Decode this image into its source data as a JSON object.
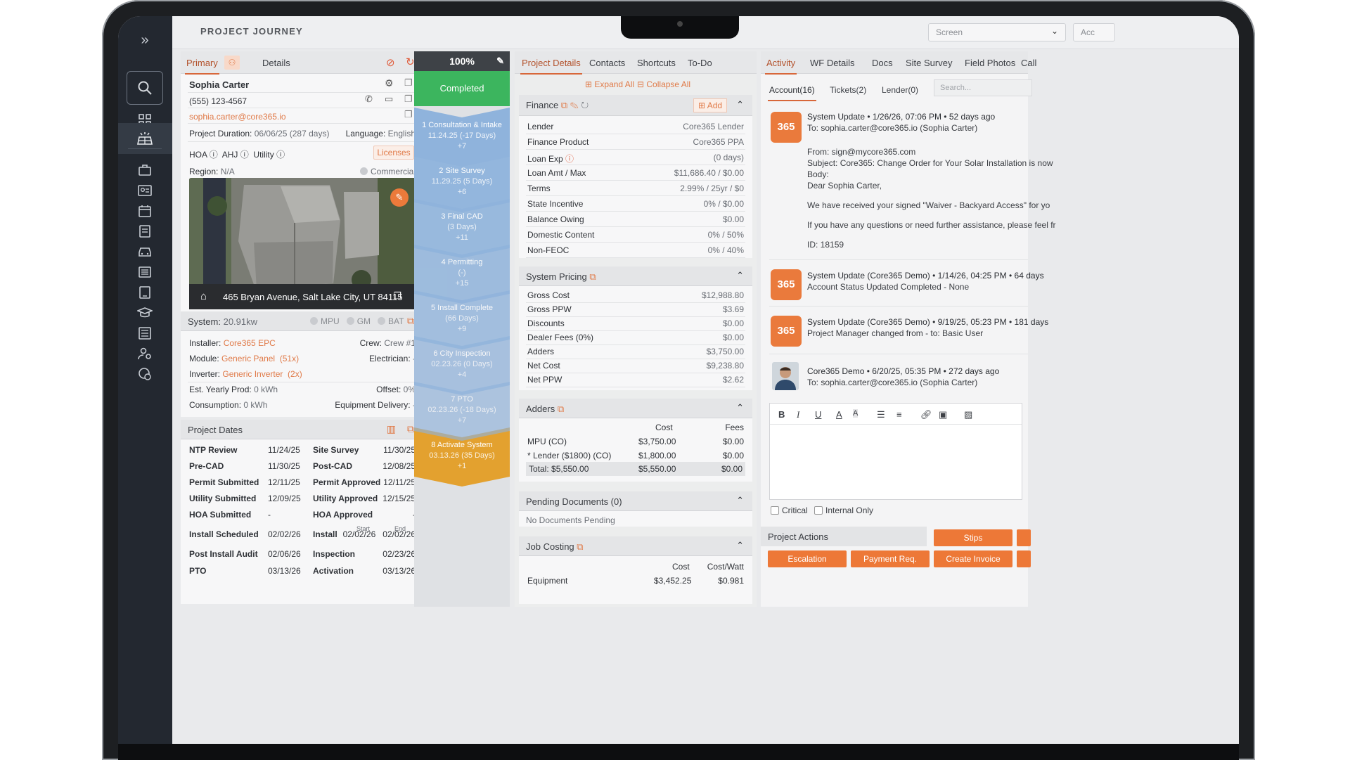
{
  "header": {
    "title": "PROJECT JOURNEY",
    "screen_select": "Screen",
    "acc_label": "Acc"
  },
  "primary": {
    "tabs": [
      "Primary",
      "Details"
    ],
    "name": "Sophia Carter",
    "phone": "(555) 123-4567",
    "email": "sophia.carter@core365.io",
    "duration_label": "Project Duration:",
    "duration_value": "06/06/25 (287 days)",
    "language_label": "Language:",
    "language_value": "English",
    "hoa": "HOA",
    "ahj": "AHJ",
    "utility": "Utility",
    "licenses": "Licenses",
    "region_label": "Region:",
    "region_value": "N/A",
    "commercial": "Commercial",
    "address": "465 Bryan Avenue, Salt Lake City, UT 84115"
  },
  "system": {
    "title": "System:",
    "size": "20.91kw",
    "flags": [
      "MPU",
      "GM",
      "BAT"
    ],
    "installer_label": "Installer:",
    "installer": "Core365 EPC",
    "crew_label": "Crew:",
    "crew": "Crew #1",
    "module_label": "Module:",
    "module": "Generic Panel  (51x)",
    "electrician_label": "Electrician:",
    "electrician": "-",
    "inverter_label": "Inverter:",
    "inverter": "Generic Inverter  (2x)",
    "prod_label": "Est. Yearly Prod:",
    "prod": "0 kWh",
    "offset_label": "Offset:",
    "offset": "0%",
    "consumption_label": "Consumption:",
    "consumption": "0 kWh",
    "delivery_label": "Equipment Delivery:",
    "delivery": "-"
  },
  "dates": {
    "title": "Project Dates",
    "rows": [
      [
        "NTP Review",
        "11/24/25",
        "Site Survey",
        "11/30/25"
      ],
      [
        "Pre-CAD",
        "11/30/25",
        "Post-CAD",
        "12/08/25"
      ],
      [
        "Permit Submitted",
        "12/11/25",
        "Permit Approved",
        "12/11/25"
      ],
      [
        "Utility Submitted",
        "12/09/25",
        "Utility Approved",
        "12/15/25"
      ],
      [
        "HOA Submitted",
        "-",
        "HOA Approved",
        "-"
      ],
      [
        "Install Scheduled",
        "02/02/26",
        "Install",
        "02/02/26   02/02/26"
      ],
      [
        "Post Install Audit",
        "02/06/26",
        "Inspection",
        "02/23/26"
      ],
      [
        "PTO",
        "03/13/26",
        "Activation",
        "03/13/26"
      ]
    ],
    "start_label": "Start",
    "end_label": "End"
  },
  "timeline": {
    "percent": "100%",
    "status": "Completed",
    "stages": [
      {
        "title": "1 Consultation & Intake",
        "sub": "11.24.25 (-17 Days)",
        "delta": "+7"
      },
      {
        "title": "2 Site Survey",
        "sub": "11.29.25 (5 Days)",
        "delta": "+6"
      },
      {
        "title": "3 Final CAD",
        "sub": "(3 Days)",
        "delta": "+11"
      },
      {
        "title": "4 Permitting",
        "sub": "(-)",
        "delta": "+15"
      },
      {
        "title": "5 Install Complete",
        "sub": "(66 Days)",
        "delta": "+9"
      },
      {
        "title": "6 City Inspection",
        "sub": "02.23.26 (0 Days)",
        "delta": "+4"
      },
      {
        "title": "7 PTO",
        "sub": "02.23.26 (-18 Days)",
        "delta": "+7"
      },
      {
        "title": "8 Activate System",
        "sub": "03.13.26 (35 Days)",
        "delta": "+1"
      }
    ]
  },
  "project": {
    "tabs": [
      "Project Details",
      "Contacts",
      "Shortcuts",
      "To-Do"
    ],
    "expand_all": "Expand All",
    "collapse_all": "Collapse All",
    "finance": {
      "title": "Finance",
      "add": "Add",
      "rows": [
        [
          "Lender",
          "Core365 Lender"
        ],
        [
          "Finance Product",
          "Core365 PPA"
        ],
        [
          "Loan Exp",
          "(0 days)"
        ],
        [
          "Loan Amt / Max",
          "$11,686.40 / $0.00"
        ],
        [
          "Terms",
          "2.99% / 25yr / $0"
        ],
        [
          "State Incentive",
          "0% / $0.00"
        ],
        [
          "Balance Owing",
          "$0.00"
        ],
        [
          "Domestic Content",
          "0% / 50%"
        ],
        [
          "Non-FEOC",
          "0% / 40%"
        ]
      ]
    },
    "pricing": {
      "title": "System Pricing",
      "rows": [
        [
          "Gross Cost",
          "$12,988.80"
        ],
        [
          "Gross PPW",
          "$3.69"
        ],
        [
          "Discounts",
          "$0.00"
        ],
        [
          "Dealer Fees (0%)",
          "$0.00"
        ],
        [
          "Adders",
          "$3,750.00"
        ],
        [
          "Net Cost",
          "$9,238.80"
        ],
        [
          "Net PPW",
          "$2.62"
        ]
      ]
    },
    "adders": {
      "title": "Adders",
      "cost_h": "Cost",
      "fees_h": "Fees",
      "rows": [
        [
          "MPU (CO)",
          "$3,750.00",
          "$0.00"
        ],
        [
          "* Lender ($1800) (CO)",
          "$1,800.00",
          "$0.00"
        ]
      ],
      "total": [
        "Total: $5,550.00",
        "$5,550.00",
        "$0.00"
      ]
    },
    "pending": {
      "title": "Pending Documents (0)",
      "empty": "No Documents Pending"
    },
    "jobcost": {
      "title": "Job Costing",
      "cost_h": "Cost",
      "cw_h": "Cost/Watt",
      "rows": [
        [
          "Equipment",
          "$3,452.25",
          "$0.981"
        ]
      ]
    }
  },
  "activity": {
    "tabs": [
      "Activity",
      "WF Details",
      "Docs",
      "Site Survey",
      "Field Photos",
      "Call"
    ],
    "subtabs": [
      "Account(16)",
      "Tickets(2)",
      "Lender(0)"
    ],
    "search": "Search...",
    "logo_text": "365",
    "items": [
      {
        "title": "System Update • 1/26/26, 07:06 PM • 52 days ago",
        "to": "To: sophia.carter@core365.io (Sophia Carter)",
        "body": [
          "From: sign@mycore365.com",
          "Subject: Core365: Change Order for Your Solar Installation is now",
          "Body:",
          "Dear Sophia Carter,",
          "We have received your signed \"Waiver - Backyard Access\" for yo",
          "If you have any questions or need further assistance, please feel fr",
          "ID: 18159"
        ]
      },
      {
        "title": "System Update (Core365 Demo) • 1/14/26, 04:25 PM • 64 days",
        "line": "Account Status Updated Completed - None"
      },
      {
        "title": "System Update (Core365 Demo) • 9/19/25, 05:23 PM • 181 days",
        "line": "Project Manager changed from - to: Basic User"
      },
      {
        "title": "Core365 Demo • 6/20/25, 05:35 PM • 272 days ago",
        "line": "To: sophia.carter@core365.io (Sophia Carter)"
      }
    ],
    "critical": "Critical",
    "internal": "Internal Only",
    "actions_title": "Project Actions",
    "buttons": [
      "Stips",
      "Escalation",
      "Payment Req.",
      "Create Invoice"
    ]
  },
  "colors": {
    "accent": "#ed7837",
    "complete": "#3cb55e",
    "stage_blue": "#8fb3dc",
    "stage_gold": "#e3a12f",
    "sidebar": "#232830"
  }
}
